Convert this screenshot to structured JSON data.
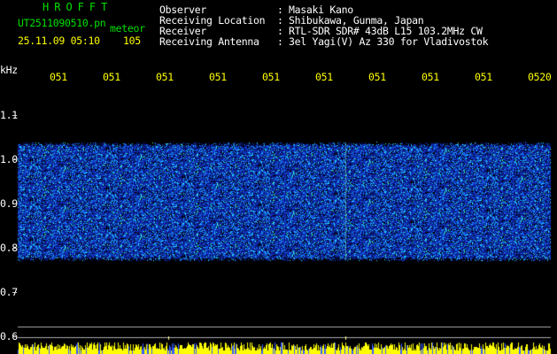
{
  "logo": "HROFFT",
  "file": {
    "name": "UT2511090510.pn",
    "type": "meteor",
    "datetime": "25.11.09 05:10",
    "count": "105"
  },
  "header": {
    "rows": [
      {
        "label": "Observer",
        "value": "Masaki Kano"
      },
      {
        "label": "Receiving Location",
        "value": "Shibukawa, Gunma, Japan"
      },
      {
        "label": "Receiver",
        "value": "RTL-SDR SDR# 43dB L15 103.2MHz CW"
      },
      {
        "label": "Receiving Antenna",
        "value": "3el Yagi(V) Az 330 for Vladivostok"
      }
    ]
  },
  "chart_data": {
    "type": "heatmap",
    "ylabel": "kHz",
    "time_ticks": [
      "051",
      "051",
      "051",
      "051",
      "051",
      "051",
      "051",
      "051",
      "051",
      "0520"
    ],
    "freq_ticks": [
      "1.1",
      "1.0",
      "0.9",
      "0.8",
      "0.7",
      "0.6"
    ],
    "freq_range": [
      0.6,
      1.15
    ],
    "signal_band_khz": [
      0.78,
      1.03
    ],
    "colors": {
      "background": "#000000",
      "signal_low": "#0a1a8c",
      "signal_high": "#19d6ff",
      "bottom_bar": "#ffff00"
    }
  }
}
